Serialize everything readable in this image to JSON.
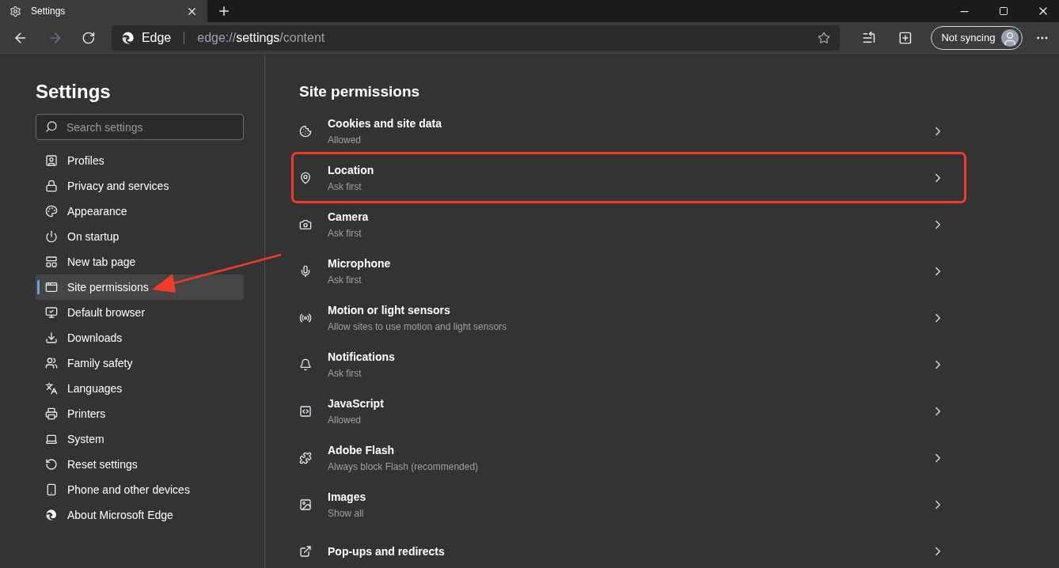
{
  "tab": {
    "title": "Settings"
  },
  "address_bar": {
    "site_label": "Edge",
    "url_prefix": "edge://",
    "url_host": "settings",
    "url_path": "/content"
  },
  "profile_button": {
    "label": "Not syncing"
  },
  "sidebar": {
    "title": "Settings",
    "search": {
      "placeholder": "Search settings"
    },
    "items": [
      {
        "label": "Profiles",
        "selected": false
      },
      {
        "label": "Privacy and services",
        "selected": false
      },
      {
        "label": "Appearance",
        "selected": false
      },
      {
        "label": "On startup",
        "selected": false
      },
      {
        "label": "New tab page",
        "selected": false
      },
      {
        "label": "Site permissions",
        "selected": true
      },
      {
        "label": "Default browser",
        "selected": false
      },
      {
        "label": "Downloads",
        "selected": false
      },
      {
        "label": "Family safety",
        "selected": false
      },
      {
        "label": "Languages",
        "selected": false
      },
      {
        "label": "Printers",
        "selected": false
      },
      {
        "label": "System",
        "selected": false
      },
      {
        "label": "Reset settings",
        "selected": false
      },
      {
        "label": "Phone and other devices",
        "selected": false
      },
      {
        "label": "About Microsoft Edge",
        "selected": false
      }
    ]
  },
  "content": {
    "heading": "Site permissions",
    "permissions": [
      {
        "title": "Cookies and site data",
        "status": "Allowed",
        "highlighted": false
      },
      {
        "title": "Location",
        "status": "Ask first",
        "highlighted": true
      },
      {
        "title": "Camera",
        "status": "Ask first",
        "highlighted": false
      },
      {
        "title": "Microphone",
        "status": "Ask first",
        "highlighted": false
      },
      {
        "title": "Motion or light sensors",
        "status": "Allow sites to use motion and light sensors",
        "highlighted": false
      },
      {
        "title": "Notifications",
        "status": "Ask first",
        "highlighted": false
      },
      {
        "title": "JavaScript",
        "status": "Allowed",
        "highlighted": false
      },
      {
        "title": "Adobe Flash",
        "status": "Always block Flash (recommended)",
        "highlighted": false
      },
      {
        "title": "Images",
        "status": "Show all",
        "highlighted": false
      },
      {
        "title": "Pop-ups and redirects",
        "highlighted": false
      }
    ]
  }
}
